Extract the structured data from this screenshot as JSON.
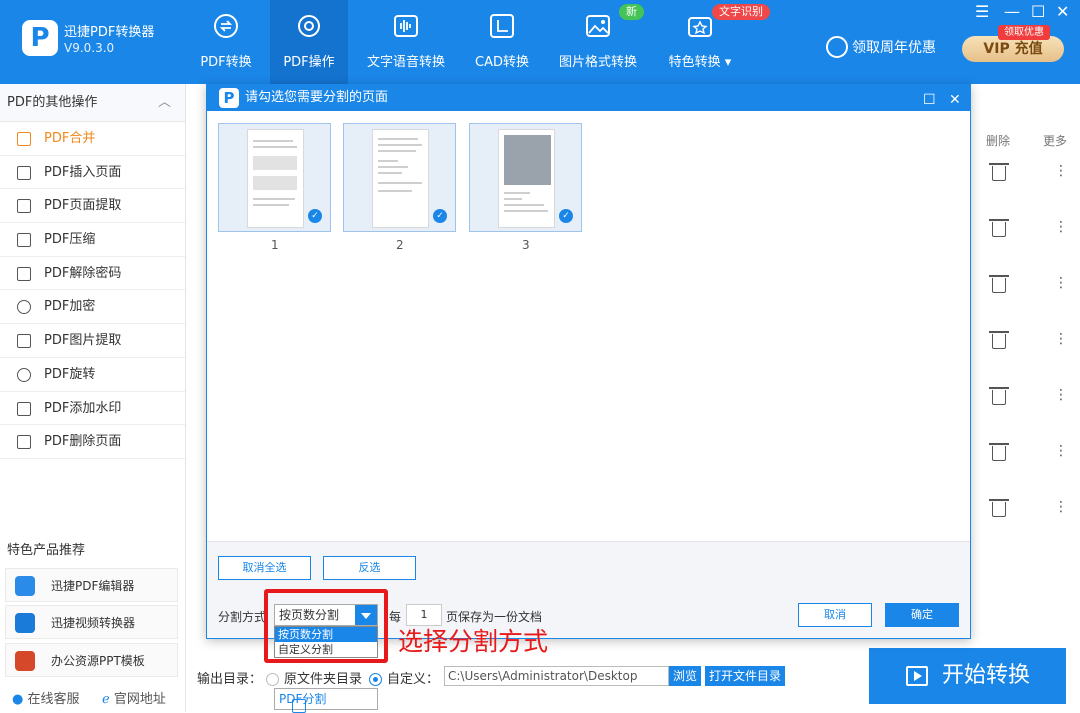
{
  "app": {
    "name": "迅捷PDF转换器",
    "version": "V9.0.3.0"
  },
  "nav": {
    "tabs": [
      {
        "label": "PDF转换"
      },
      {
        "label": "PDF操作"
      },
      {
        "label": "文字语音转换"
      },
      {
        "label": "CAD转换"
      },
      {
        "label": "图片格式转换"
      },
      {
        "label": "特色转换"
      }
    ],
    "badge_new": "新",
    "badge_ocr": "文字识别",
    "promo": "领取周年优惠",
    "vip_label": "VIP 充值",
    "vip_badge": "领取优惠"
  },
  "window": {
    "menu": "☰",
    "minimize": "—",
    "maximize": "☐",
    "close": "✕"
  },
  "sidebar": {
    "header": "PDF的其他操作",
    "items": [
      {
        "label": "PDF合并"
      },
      {
        "label": "PDF分割"
      },
      {
        "label": "PDF插入页面"
      },
      {
        "label": "PDF页面提取"
      },
      {
        "label": "PDF压缩"
      },
      {
        "label": "PDF解除密码"
      },
      {
        "label": "PDF加密"
      },
      {
        "label": "PDF图片提取"
      },
      {
        "label": "PDF旋转"
      },
      {
        "label": "PDF添加水印"
      },
      {
        "label": "PDF删除页面"
      }
    ],
    "rec_title": "特色产品推荐",
    "products": [
      {
        "label": "迅捷PDF编辑器"
      },
      {
        "label": "迅捷视频转换器"
      },
      {
        "label": "办公资源PPT模板"
      }
    ],
    "footer": {
      "service": "在线客服",
      "site": "官网地址"
    }
  },
  "main": {
    "col_delete": "删除",
    "col_more": "更多",
    "output_label": "输出目录：",
    "radio_original": "原文件夹目录",
    "radio_custom": "自定义：",
    "path": "C:\\Users\\Administrator\\Desktop",
    "browse": "浏览",
    "open_dir": "打开文件目录",
    "start": "开始转换"
  },
  "dialog": {
    "title": "请勾选您需要分割的页面",
    "pages": [
      {
        "num": "1"
      },
      {
        "num": "2"
      },
      {
        "num": "3"
      }
    ],
    "deselect_all": "取消全选",
    "invert": "反选",
    "split_label": "分割方式",
    "split_value": "按页数分割",
    "options": [
      "按页数分割",
      "自定义分割"
    ],
    "every": "每",
    "page_count": "1",
    "every_suffix": "页保存为一份文档",
    "cancel": "取消",
    "ok": "确定"
  },
  "annotation": "选择分割方式",
  "colors": {
    "accent": "#1a86e8",
    "nav_active": "#1473cf",
    "highlight": "#f08a1c",
    "annotation": "#e8191b"
  }
}
